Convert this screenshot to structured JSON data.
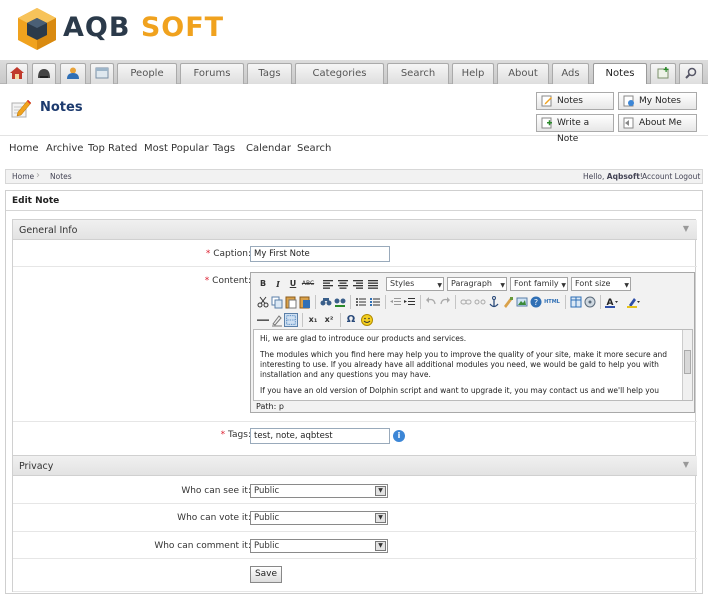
{
  "brand": {
    "part1": "AQB",
    "part2": " SOFT"
  },
  "topnav": {
    "icons": [
      "home-icon",
      "helmet-icon",
      "user-icon",
      "window-icon"
    ],
    "tabs": [
      "People",
      "Forums",
      "Tags",
      "Categories",
      "Search",
      "Help",
      "About",
      "Ads",
      "Notes"
    ],
    "right_icons": [
      "add-icon",
      "search-icon"
    ]
  },
  "page": {
    "title": "Notes",
    "actions": {
      "notes": "Notes",
      "my_notes": "My Notes",
      "write_note": "Write a Note",
      "about_me": "About Me"
    }
  },
  "subnav": [
    "Home",
    "Archive",
    "Top Rated",
    "Most Popular",
    "Tags",
    "Calendar",
    "Search"
  ],
  "breadcrumb": {
    "home": "Home",
    "current": "Notes",
    "greeting": "Hello, ",
    "username": "Aqbsoft",
    "bang": "!",
    "logout": "Account Logout"
  },
  "form": {
    "title": "Edit Note",
    "general_title": "General Info",
    "privacy_title": "Privacy",
    "caption_label": "Caption:",
    "caption_value": "My First Note",
    "content_label": "Content:",
    "tags_label": "Tags:",
    "tags_value": "test, note, aqbtest",
    "req": "*",
    "see_label": "Who can see it:",
    "vote_label": "Who can vote it:",
    "comment_label": "Who can comment it:",
    "see_value": "Public",
    "vote_value": "Public",
    "comment_value": "Public",
    "save": "Save"
  },
  "editor": {
    "styles": "Styles",
    "paragraph": "Paragraph",
    "font_family": "Font family",
    "font_size": "Font size",
    "bold": "B",
    "italic": "I",
    "underline": "U",
    "strike": "ABC",
    "sub": "x₁",
    "sup": "x²",
    "omega": "Ω",
    "html": "HTML",
    "para1": "Hi, we are glad to introduce our products and services.",
    "para2": "The modules which you find here may help you to improve the quality of your site, make it more secure and interesting to use. If you already have all additional modules you need, we would be gald to help you with installation and any questions you may have.",
    "para3": "If you have an old version of Dolphin script and want to upgrade it, you may contact us and we'll help you",
    "path": "Path: p"
  },
  "colors": {
    "brand_dark": "#2b3a4a",
    "brand_orange": "#f0a21e",
    "title_blue": "#1c3a6e",
    "required_red": "#d23"
  }
}
